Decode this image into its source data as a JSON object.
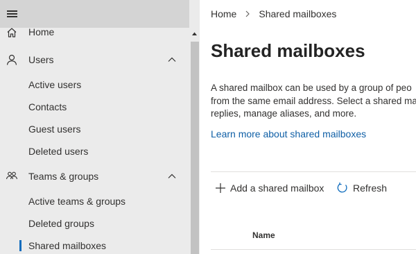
{
  "sidebar": {
    "items": [
      {
        "label": "Home",
        "icon": "home-icon"
      },
      {
        "label": "Users",
        "icon": "person-icon",
        "expanded": true
      },
      {
        "label": "Active users"
      },
      {
        "label": "Contacts"
      },
      {
        "label": "Guest users"
      },
      {
        "label": "Deleted users"
      },
      {
        "label": "Teams & groups",
        "icon": "people-icon",
        "expanded": true
      },
      {
        "label": "Active teams & groups"
      },
      {
        "label": "Deleted groups"
      },
      {
        "label": "Shared mailboxes",
        "selected": true
      }
    ]
  },
  "breadcrumb": {
    "home": "Home",
    "current": "Shared mailboxes"
  },
  "main": {
    "title": "Shared mailboxes",
    "description_lines": [
      "A shared mailbox can be used by a group of peo",
      "from the same email address. Select a shared ma",
      "replies, manage aliases, and more."
    ],
    "learn_more": "Learn more about shared mailboxes",
    "commands": {
      "add": "Add a shared mailbox",
      "refresh": "Refresh"
    },
    "table": {
      "columns": [
        "Name"
      ]
    }
  },
  "colors": {
    "accent": "#0f6cbd",
    "link": "#0f5fa6",
    "sidebar_bg": "#ebebeb",
    "topbar_bg": "#d4d4d4"
  }
}
